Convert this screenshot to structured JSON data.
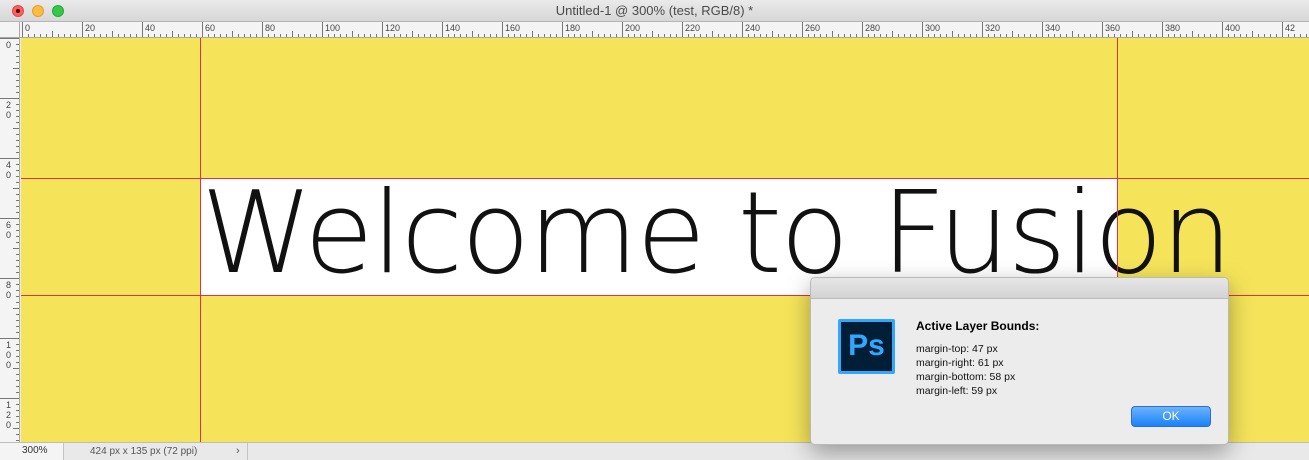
{
  "window": {
    "title": "Untitled-1 @ 300% (test, RGB/8) *"
  },
  "ruler": {
    "top_labels": [
      "0",
      "20",
      "40",
      "60",
      "80",
      "100",
      "120",
      "140",
      "160",
      "180",
      "200",
      "220",
      "240",
      "260",
      "280",
      "300",
      "320",
      "340",
      "360",
      "380",
      "400",
      "42"
    ],
    "left_labels": [
      "0",
      "2\n0",
      "4\n0",
      "6\n0",
      "8\n0",
      "1\n0\n0",
      "1\n2\n0"
    ]
  },
  "canvas": {
    "text": "Welcome to Fusion",
    "background_color": "#f5e45a",
    "guide_color": "#e0304a"
  },
  "statusbar": {
    "zoom": "300%",
    "doc_info": "424 px x 135 px (72 ppi)",
    "chevron": "›"
  },
  "dialog": {
    "icon": "photoshop-app-icon",
    "icon_text": "Ps",
    "heading": "Active Layer Bounds:",
    "lines": [
      "margin-top: 47 px",
      "margin-right: 61 px",
      "margin-bottom: 58 px",
      "margin-left: 59 px"
    ],
    "ok_label": "OK"
  }
}
